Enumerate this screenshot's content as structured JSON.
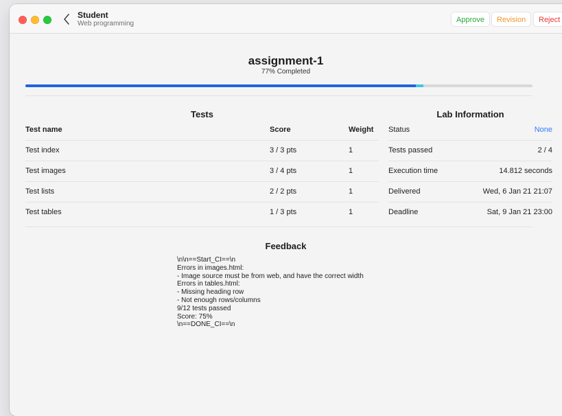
{
  "window": {
    "title": "Student",
    "subtitle": "Web programming"
  },
  "toolbar": {
    "approve_label": "Approve",
    "revision_label": "Revision",
    "reject_label": "Reject"
  },
  "assignment": {
    "name": "assignment-1",
    "completed_text": "77% Completed",
    "progress": 0.77,
    "progress_extra": 0.015
  },
  "tests": {
    "title": "Tests",
    "headers": {
      "name": "Test name",
      "score": "Score",
      "weight": "Weight"
    },
    "rows": [
      {
        "name": "Test index",
        "score": "3 / 3 pts",
        "weight": "1"
      },
      {
        "name": "Test images",
        "score": "3 / 4 pts",
        "weight": "1"
      },
      {
        "name": "Test lists",
        "score": "2 / 2 pts",
        "weight": "1"
      },
      {
        "name": "Test tables",
        "score": "1 / 3 pts",
        "weight": "1"
      }
    ]
  },
  "lab": {
    "title": "Lab Information",
    "rows": [
      {
        "key": "Status",
        "value": "None",
        "accent": true
      },
      {
        "key": "Tests passed",
        "value": "2 / 4"
      },
      {
        "key": "Execution time",
        "value": "14.812 seconds"
      },
      {
        "key": "Delivered",
        "value": "Wed, 6 Jan 21 21:07"
      },
      {
        "key": "Deadline",
        "value": "Sat, 9 Jan 21 23:00"
      }
    ]
  },
  "feedback": {
    "title": "Feedback",
    "text": "\\n\\n==Start_CI==\\n\nErrors in images.html:\n- Image source must be from web, and have the correct width\nErrors in tables.html:\n- Missing heading row\n- Not enough rows/columns\n9/12 tests passed\nScore: 75%\n\\n==DONE_CI==\\n"
  },
  "colors": {
    "progress": "#1f63e0",
    "progress_extra": "#3cc7e8",
    "approve": "#2aa83a",
    "revision": "#f0962a",
    "reject": "#e5383b",
    "accent": "#2f7cf6"
  }
}
